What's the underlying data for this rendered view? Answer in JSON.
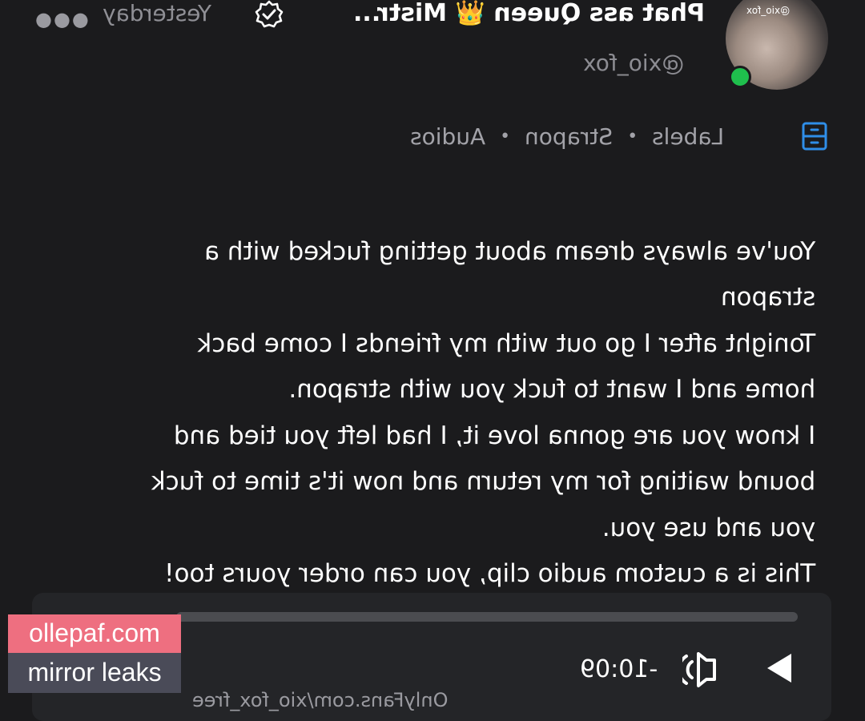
{
  "post": {
    "author": {
      "display_name": "Phat ass Queen 👑 Mistr...",
      "handle": "@xio_fox",
      "avatar_tag": "@xio_fox",
      "online": true
    },
    "date": "Yesterday",
    "labels_title": "Labels",
    "labels": [
      "Strapon",
      "Audios"
    ],
    "body_lines": [
      "You've always dream about getting fucked with a",
      "strapon",
      "Tonight after I go out with my friends I come back",
      "home and I want to fuck you with strapon.",
      "I know you are gonna love it, I had left you tied and",
      "bound waiting for my return and now it's time to fuck",
      "you and use you.",
      "This is a custom audio clip, you can order yours too!"
    ]
  },
  "player": {
    "time_remaining": "-10:09",
    "progress": 0
  },
  "source_text": "OnlyFans.com/xio_fox_free",
  "watermark": {
    "site": "ollepaf.com",
    "tagline": "mirror leaks"
  },
  "colors": {
    "background": "#1b1b1d",
    "accent_blue": "#2f8ee8",
    "online_green": "#1fbf4d",
    "watermark_pink": "#ee6f80"
  }
}
